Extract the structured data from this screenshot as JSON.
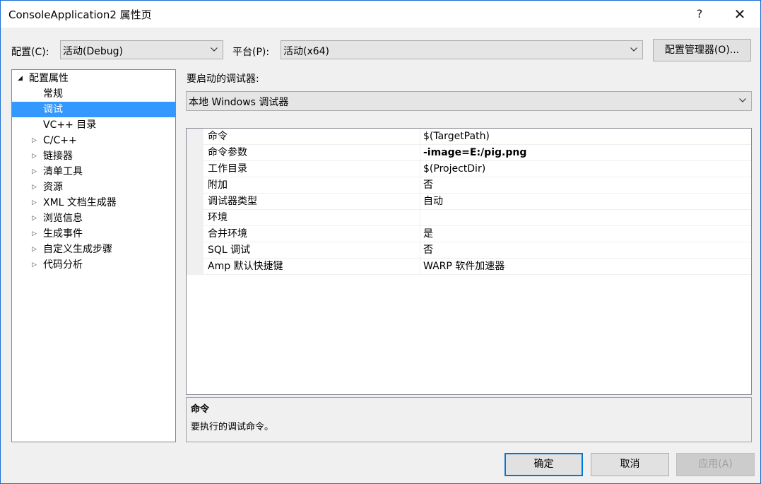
{
  "window": {
    "title": "ConsoleApplication2 属性页",
    "help": "?",
    "close": "✕"
  },
  "toolbar": {
    "config_label": "配置(C):",
    "config_value": "活动(Debug)",
    "platform_label": "平台(P):",
    "platform_value": "活动(x64)",
    "config_manager_label": "配置管理器(O)..."
  },
  "tree": {
    "root_expander": "◢",
    "root_label": "配置属性",
    "collapsed_expander": "▷",
    "items": [
      {
        "label": "常规"
      },
      {
        "label": "调试",
        "selected": true
      },
      {
        "label": "VC++ 目录"
      },
      {
        "label": "C/C++",
        "expandable": true
      },
      {
        "label": "链接器",
        "expandable": true
      },
      {
        "label": "清单工具",
        "expandable": true
      },
      {
        "label": "资源",
        "expandable": true
      },
      {
        "label": "XML 文档生成器",
        "expandable": true
      },
      {
        "label": "浏览信息",
        "expandable": true
      },
      {
        "label": "生成事件",
        "expandable": true
      },
      {
        "label": "自定义生成步骤",
        "expandable": true
      },
      {
        "label": "代码分析",
        "expandable": true
      }
    ]
  },
  "debugger": {
    "label": "要启动的调试器:",
    "value": "本地 Windows 调试器"
  },
  "properties": [
    {
      "name": "命令",
      "value": "$(TargetPath)"
    },
    {
      "name": "命令参数",
      "value": "-image=E:/pig.png",
      "bold": true
    },
    {
      "name": "工作目录",
      "value": "$(ProjectDir)"
    },
    {
      "name": "附加",
      "value": "否"
    },
    {
      "name": "调试器类型",
      "value": "自动"
    },
    {
      "name": "环境",
      "value": ""
    },
    {
      "name": "合并环境",
      "value": "是"
    },
    {
      "name": "SQL 调试",
      "value": "否"
    },
    {
      "name": "Amp 默认快捷键",
      "value": "WARP 软件加速器"
    }
  ],
  "description": {
    "title": "命令",
    "text": "要执行的调试命令。"
  },
  "buttons": {
    "ok": "确定",
    "cancel": "取消",
    "apply": "应用(A)"
  },
  "colors": {
    "selection": "#3399ff",
    "accent_border": "#0078d7"
  }
}
